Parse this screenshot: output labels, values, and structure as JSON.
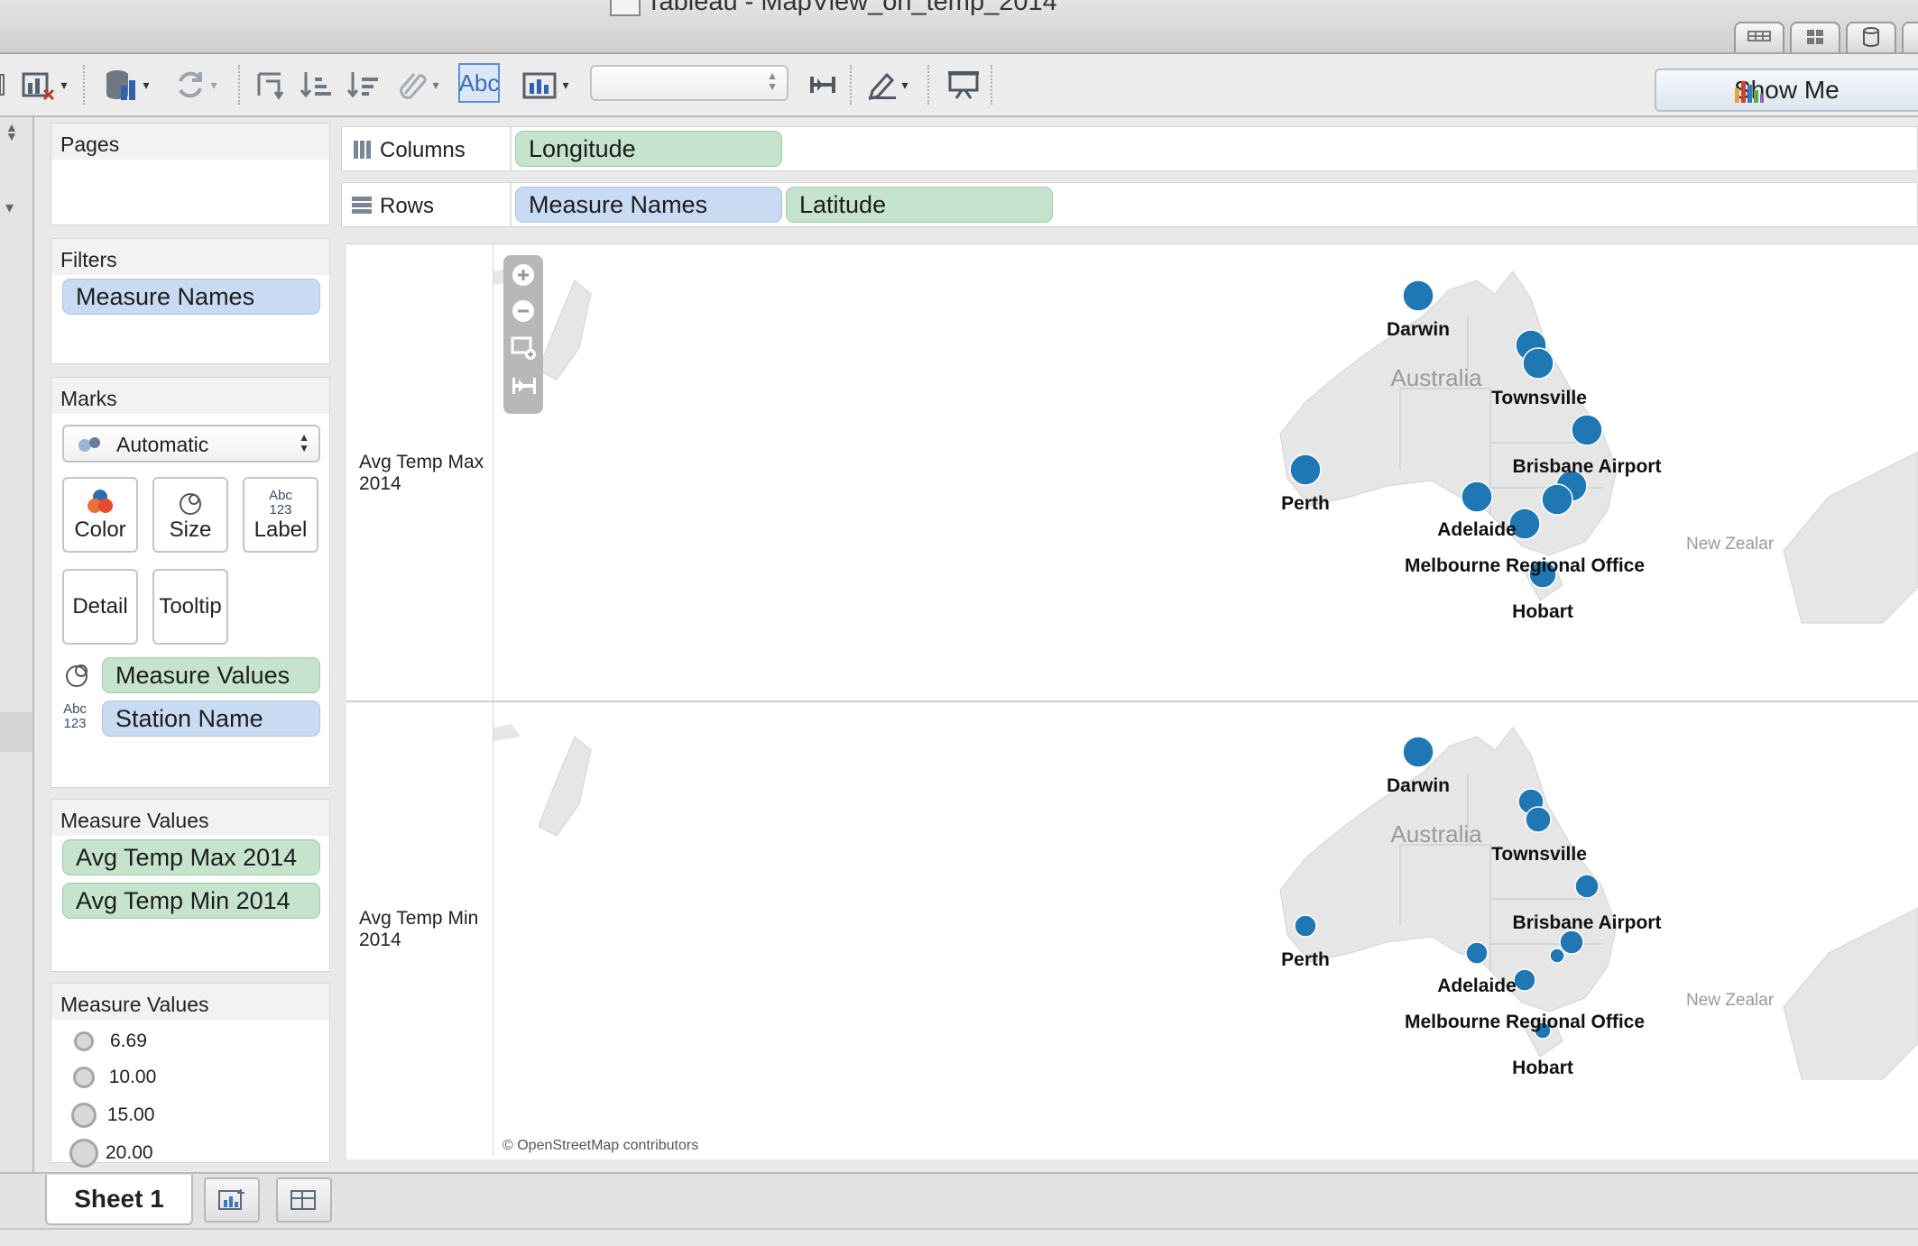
{
  "window": {
    "title": "Tableau - MapView_on_temp_2014"
  },
  "toolbar": {
    "abc_label": "Abc",
    "show_me_label": "Show Me"
  },
  "pages": {
    "title": "Pages"
  },
  "filters": {
    "title": "Filters",
    "pills": [
      "Measure Names"
    ]
  },
  "marks": {
    "title": "Marks",
    "mark_type": "Automatic",
    "cards": {
      "color": "Color",
      "size": "Size",
      "label": "Label",
      "detail": "Detail",
      "tooltip": "Tooltip"
    },
    "label_icon_text": "Abc\n123",
    "fields": [
      {
        "name": "Measure Values",
        "encoding": "size-icon"
      },
      {
        "name": "Station Name",
        "encoding": "label-icon"
      }
    ]
  },
  "measure_values_shelf": {
    "title": "Measure Values",
    "pills": [
      "Avg Temp Max 2014",
      "Avg Temp Min 2014"
    ]
  },
  "size_legend": {
    "title": "Measure Values",
    "items": [
      {
        "label": "6.69",
        "value": 6.69
      },
      {
        "label": "10.00",
        "value": 10.0
      },
      {
        "label": "15.00",
        "value": 15.0
      },
      {
        "label": "20.00",
        "value": 20.0
      }
    ]
  },
  "shelves": {
    "columns": {
      "label": "Columns",
      "pills": [
        "Longitude"
      ]
    },
    "rows": {
      "label": "Rows",
      "pills": [
        "Measure Names",
        "Latitude"
      ]
    }
  },
  "view": {
    "panes": [
      {
        "measure": "Avg Temp Max 2014",
        "label_line1": "Avg Temp Max",
        "label_line2": "2014"
      },
      {
        "measure": "Avg Temp Min 2014",
        "label_line1": "Avg Temp Min",
        "label_line2": "2014"
      }
    ],
    "country_label": "Australia",
    "nz_label": "New Zealar",
    "attribution": "© OpenStreetMap contributors",
    "mark_color": "#1f77b4",
    "stations": [
      {
        "name": "Darwin",
        "labeled": true
      },
      {
        "name": "Townsville",
        "labeled": false
      },
      {
        "name": "Townsville",
        "labeled": true
      },
      {
        "name": "Brisbane Airport",
        "labeled": true
      },
      {
        "name": "Perth",
        "labeled": true
      },
      {
        "name": "Adelaide",
        "labeled": true
      },
      {
        "name": "Melbourne Regional Office",
        "labeled": true
      },
      {
        "name": "Hobart",
        "labeled": true
      },
      {
        "name": "",
        "labeled": false
      },
      {
        "name": "",
        "labeled": false
      }
    ]
  },
  "sheet_tabs": {
    "active": "Sheet 1"
  }
}
